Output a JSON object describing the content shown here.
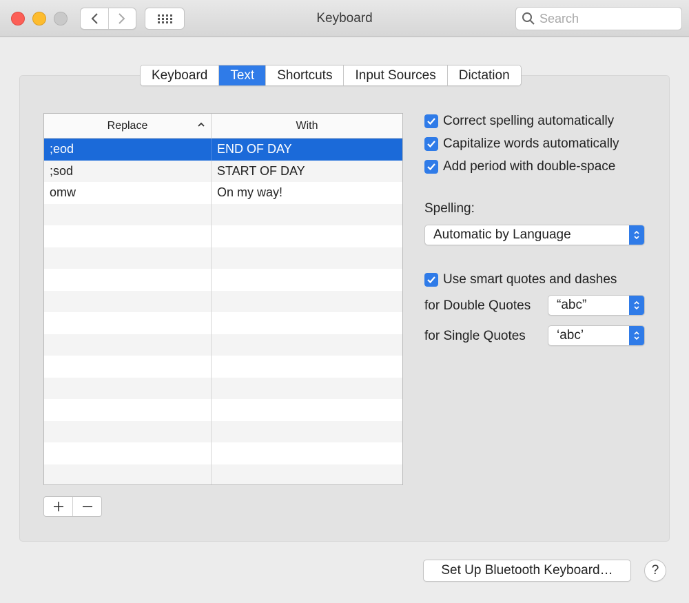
{
  "window": {
    "title": "Keyboard",
    "search_placeholder": "Search"
  },
  "tabs": [
    {
      "label": "Keyboard",
      "active": false
    },
    {
      "label": "Text",
      "active": true
    },
    {
      "label": "Shortcuts",
      "active": false
    },
    {
      "label": "Input Sources",
      "active": false
    },
    {
      "label": "Dictation",
      "active": false
    }
  ],
  "table": {
    "columns": [
      "Replace",
      "With"
    ],
    "sorted_column": "Replace",
    "rows": [
      {
        "replace": ";eod",
        "with": "END OF DAY",
        "selected": true
      },
      {
        "replace": ";sod",
        "with": "START OF DAY",
        "selected": false
      },
      {
        "replace": "omw",
        "with": "On my way!",
        "selected": false
      }
    ]
  },
  "table_buttons": {
    "add": "+",
    "remove": "−"
  },
  "options": {
    "correct_spelling": {
      "label": "Correct spelling automatically",
      "checked": true
    },
    "capitalize_words": {
      "label": "Capitalize words automatically",
      "checked": true
    },
    "add_period": {
      "label": "Add period with double-space",
      "checked": true
    },
    "spelling_label": "Spelling:",
    "spelling_value": "Automatic by Language",
    "smart_quotes": {
      "label": "Use smart quotes and dashes",
      "checked": true
    },
    "double_quotes_label": "for Double Quotes",
    "double_quotes_value": "“abc”",
    "single_quotes_label": "for Single Quotes",
    "single_quotes_value": "‘abc’"
  },
  "footer": {
    "bluetooth_button": "Set Up Bluetooth Keyboard…",
    "help_button": "?"
  },
  "colors": {
    "accent": "#2f7be8",
    "selection": "#1b6ad9"
  }
}
